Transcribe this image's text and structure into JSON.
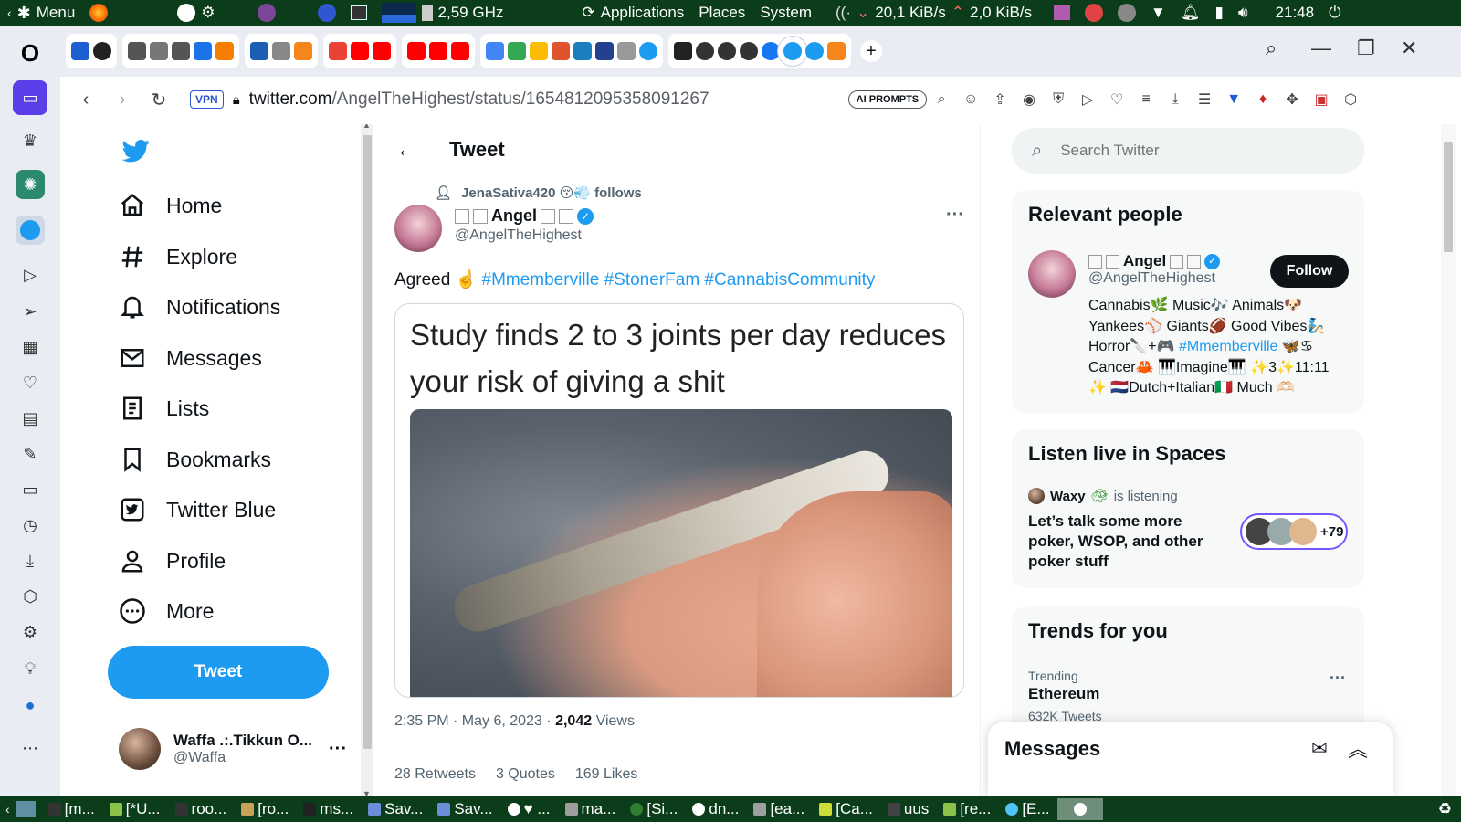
{
  "os_panel": {
    "menu_label": "Menu",
    "cpu_freq": "2,59 GHz",
    "applications_label": "Applications",
    "places_label": "Places",
    "system_label": "System",
    "net_down": "20,1 KiB/s",
    "net_up": "2,0 KiB/s",
    "clock": "21:48"
  },
  "browser": {
    "vpn_label": "VPN",
    "url_host": "twitter.com",
    "url_path": "/AngelTheHighest/status/1654812095358091267",
    "ai_prompts_label": "AI PROMPTS"
  },
  "nav": {
    "items": [
      {
        "label": "Home",
        "icon": "home-icon"
      },
      {
        "label": "Explore",
        "icon": "hashtag-icon"
      },
      {
        "label": "Notifications",
        "icon": "bell-icon"
      },
      {
        "label": "Messages",
        "icon": "mail-icon"
      },
      {
        "label": "Lists",
        "icon": "list-icon"
      },
      {
        "label": "Bookmarks",
        "icon": "bookmark-icon"
      },
      {
        "label": "Twitter Blue",
        "icon": "twitter-blue-icon"
      },
      {
        "label": "Profile",
        "icon": "person-icon"
      },
      {
        "label": "More",
        "icon": "more-circle-icon"
      }
    ],
    "tweet_button": "Tweet",
    "account_name": "Waffa .:.Tikkun O...",
    "account_handle": "@Waffa"
  },
  "main": {
    "header_title": "Tweet",
    "social_context": "JenaSativa420 😚💨 follows",
    "author_name": "Angel",
    "author_handle": "@AngelTheHighest",
    "tweet_text_prefix": "Agreed ☝️",
    "hashtags": [
      "#Mmemberville",
      "#StonerFam",
      "#CannabisCommunity"
    ],
    "meme_text": "Study finds 2 to 3 joints per day reduces your risk of giving a shit",
    "timestamp": "2:35 PM · May 6, 2023 · ",
    "views_count": "2,042",
    "views_label": " Views",
    "retweets": "28 Retweets",
    "quotes": "3 Quotes",
    "likes": "169 Likes"
  },
  "right": {
    "search_placeholder": "Search Twitter",
    "relevant_title": "Relevant people",
    "person_name": "Angel",
    "person_handle": "@AngelTheHighest",
    "follow_label": "Follow",
    "bio_lines": [
      "Cannabis🌿 Music🎶 Animals🐶",
      "Yankees⚾ Giants🏈 Good Vibes🧞",
      "Horror🔪+🎮 ",
      "Cancer🦀 🎹Imagine🎹 ✨3✨11:11",
      "✨ 🇳🇱Dutch+Italian🇮🇹 Much 🫶🏻"
    ],
    "bio_hashtag": "#Mmemberville",
    "bio_line3_suffix": " 🦋♋",
    "spaces_title": "Listen live in Spaces",
    "spaces_host": "Waxy",
    "spaces_status": "is listening",
    "spaces_topic": "Let’s talk some more poker, WSOP, and other poker stuff",
    "spaces_count": "+79",
    "trends_title": "Trends for you",
    "trend_context": "Trending",
    "trend_name": "Ethereum",
    "trend_count": "632K Tweets",
    "messages_title": "Messages"
  },
  "taskbar": {
    "tasks": [
      "[m...",
      "[*U...",
      "roo...",
      "[ro...",
      "ms...",
      "Sav...",
      "Sav...",
      "♥ ...",
      "ma...",
      "[Si...",
      "dn...",
      "[ea...",
      "[Ca...",
      "uus",
      "[re...",
      "[E..."
    ]
  },
  "colors": {
    "twitter_blue": "#1d9bf0",
    "panel_green": "#0b3d1a",
    "verified": "#1d9bf0"
  }
}
